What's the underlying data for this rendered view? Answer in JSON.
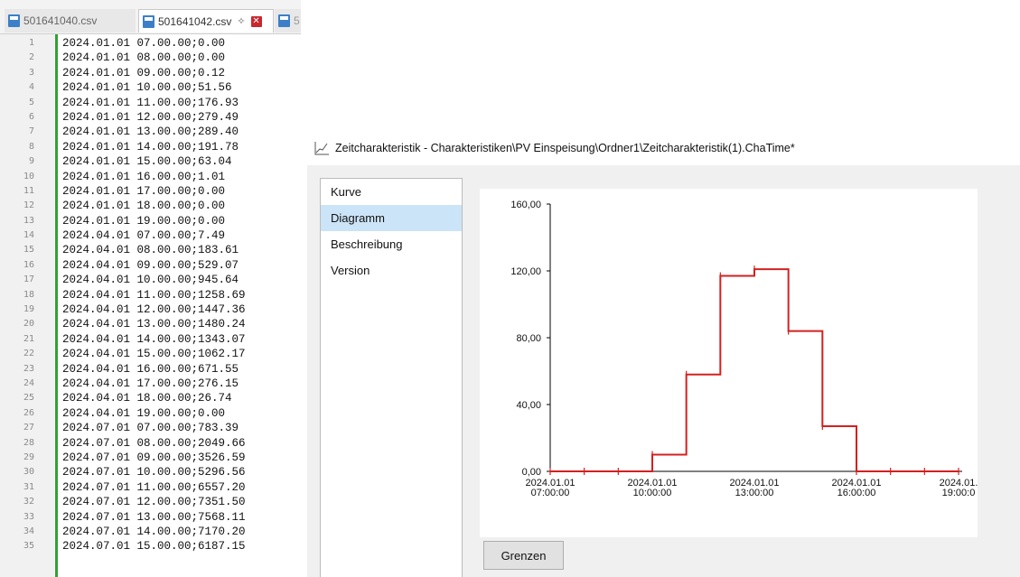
{
  "editor": {
    "tabs": [
      {
        "label": "501641040.csv"
      },
      {
        "label": "501641042.csv"
      },
      {
        "label": "5"
      }
    ],
    "lines": [
      {
        "n": "1",
        "text": "2024.01.01 07.00.00;0.00"
      },
      {
        "n": "2",
        "text": "2024.01.01 08.00.00;0.00"
      },
      {
        "n": "3",
        "text": "2024.01.01 09.00.00;0.12"
      },
      {
        "n": "4",
        "text": "2024.01.01 10.00.00;51.56"
      },
      {
        "n": "5",
        "text": "2024.01.01 11.00.00;176.93"
      },
      {
        "n": "6",
        "text": "2024.01.01 12.00.00;279.49"
      },
      {
        "n": "7",
        "text": "2024.01.01 13.00.00;289.40"
      },
      {
        "n": "8",
        "text": "2024.01.01 14.00.00;191.78"
      },
      {
        "n": "9",
        "text": "2024.01.01 15.00.00;63.04"
      },
      {
        "n": "10",
        "text": "2024.01.01 16.00.00;1.01"
      },
      {
        "n": "11",
        "text": "2024.01.01 17.00.00;0.00"
      },
      {
        "n": "12",
        "text": "2024.01.01 18.00.00;0.00"
      },
      {
        "n": "13",
        "text": "2024.01.01 19.00.00;0.00"
      },
      {
        "n": "14",
        "text": "2024.04.01 07.00.00;7.49"
      },
      {
        "n": "15",
        "text": "2024.04.01 08.00.00;183.61"
      },
      {
        "n": "16",
        "text": "2024.04.01 09.00.00;529.07"
      },
      {
        "n": "17",
        "text": "2024.04.01 10.00.00;945.64"
      },
      {
        "n": "18",
        "text": "2024.04.01 11.00.00;1258.69"
      },
      {
        "n": "19",
        "text": "2024.04.01 12.00.00;1447.36"
      },
      {
        "n": "20",
        "text": "2024.04.01 13.00.00;1480.24"
      },
      {
        "n": "21",
        "text": "2024.04.01 14.00.00;1343.07"
      },
      {
        "n": "22",
        "text": "2024.04.01 15.00.00;1062.17"
      },
      {
        "n": "23",
        "text": "2024.04.01 16.00.00;671.55"
      },
      {
        "n": "24",
        "text": "2024.04.01 17.00.00;276.15"
      },
      {
        "n": "25",
        "text": "2024.04.01 18.00.00;26.74"
      },
      {
        "n": "26",
        "text": "2024.04.01 19.00.00;0.00"
      },
      {
        "n": "27",
        "text": "2024.07.01 07.00.00;783.39"
      },
      {
        "n": "28",
        "text": "2024.07.01 08.00.00;2049.66"
      },
      {
        "n": "29",
        "text": "2024.07.01 09.00.00;3526.59"
      },
      {
        "n": "30",
        "text": "2024.07.01 10.00.00;5296.56"
      },
      {
        "n": "31",
        "text": "2024.07.01 11.00.00;6557.20"
      },
      {
        "n": "32",
        "text": "2024.07.01 12.00.00;7351.50"
      },
      {
        "n": "33",
        "text": "2024.07.01 13.00.00;7568.11"
      },
      {
        "n": "34",
        "text": "2024.07.01 14.00.00;7170.20"
      },
      {
        "n": "35",
        "text": "2024.07.01 15.00.00;6187.15"
      }
    ]
  },
  "dialog": {
    "title": "Zeitcharakteristik - Charakteristiken\\PV Einspeisung\\Ordner1\\Zeitcharakteristik(1).ChaTime*",
    "nav_items": [
      {
        "label": "Kurve",
        "selected": false
      },
      {
        "label": "Diagramm",
        "selected": true
      },
      {
        "label": "Beschreibung",
        "selected": false
      },
      {
        "label": "Version",
        "selected": false
      }
    ],
    "grenzen_label": "Grenzen"
  },
  "chart_data": {
    "type": "line",
    "line_style": "step",
    "series_color": "#d42020",
    "ylim": [
      0,
      160
    ],
    "y_ticks": [
      {
        "value": 0,
        "label": "0,00"
      },
      {
        "value": 40,
        "label": "40,00"
      },
      {
        "value": 80,
        "label": "80,00"
      },
      {
        "value": 120,
        "label": "120,00"
      },
      {
        "value": 160,
        "label": "160,00"
      }
    ],
    "xlim": [
      7,
      19
    ],
    "x_ticks": [
      {
        "value": 7,
        "date": "2024.01.01",
        "time": "07:00:00"
      },
      {
        "value": 10,
        "date": "2024.01.01",
        "time": "10:00:00"
      },
      {
        "value": 13,
        "date": "2024.01.01",
        "time": "13:00:00"
      },
      {
        "value": 16,
        "date": "2024.01.01",
        "time": "16:00:00"
      },
      {
        "value": 19,
        "date": "2024.01.",
        "time": "19:00:0"
      }
    ],
    "points": [
      {
        "x": 7,
        "y": 0
      },
      {
        "x": 8,
        "y": 0
      },
      {
        "x": 9,
        "y": 0
      },
      {
        "x": 10,
        "y": 10
      },
      {
        "x": 11,
        "y": 58
      },
      {
        "x": 12,
        "y": 117
      },
      {
        "x": 13,
        "y": 121
      },
      {
        "x": 14,
        "y": 84
      },
      {
        "x": 15,
        "y": 27
      },
      {
        "x": 16,
        "y": 0
      },
      {
        "x": 17,
        "y": 0
      },
      {
        "x": 18,
        "y": 0
      },
      {
        "x": 19,
        "y": 0
      }
    ]
  }
}
